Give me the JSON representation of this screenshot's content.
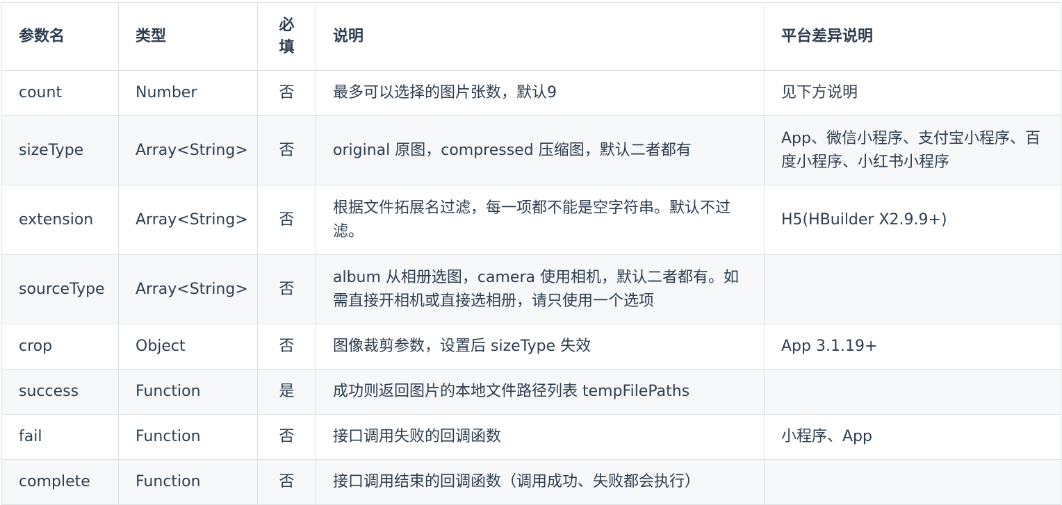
{
  "headers": {
    "name": "参数名",
    "type": "类型",
    "required_line1": "必",
    "required_line2": "填",
    "desc": "说明",
    "platform": "平台差异说明"
  },
  "rows": [
    {
      "name": "count",
      "type": "Number",
      "required": "否",
      "desc": "最多可以选择的图片张数，默认9",
      "platform": "见下方说明"
    },
    {
      "name": "sizeType",
      "type": "Array<String>",
      "required": "否",
      "desc": "original 原图，compressed 压缩图，默认二者都有",
      "platform": "App、微信小程序、支付宝小程序、百度小程序、小红书小程序"
    },
    {
      "name": "extension",
      "type": "Array<String>",
      "required": "否",
      "desc": "根据文件拓展名过滤，每一项都不能是空字符串。默认不过滤。",
      "platform": "H5(HBuilder X2.9.9+)"
    },
    {
      "name": "sourceType",
      "type": "Array<String>",
      "required": "否",
      "desc": "album 从相册选图，camera 使用相机，默认二者都有。如需直接开相机或直接选相册，请只使用一个选项",
      "platform": ""
    },
    {
      "name": "crop",
      "type": "Object",
      "required": "否",
      "desc": "图像裁剪参数，设置后 sizeType 失效",
      "platform": "App 3.1.19+"
    },
    {
      "name": "success",
      "type": "Function",
      "required": "是",
      "desc": "成功则返回图片的本地文件路径列表 tempFilePaths",
      "platform": ""
    },
    {
      "name": "fail",
      "type": "Function",
      "required": "否",
      "desc": "接口调用失败的回调函数",
      "platform": "小程序、App"
    },
    {
      "name": "complete",
      "type": "Function",
      "required": "否",
      "desc": "接口调用结束的回调函数（调用成功、失败都会执行）",
      "platform": ""
    }
  ]
}
